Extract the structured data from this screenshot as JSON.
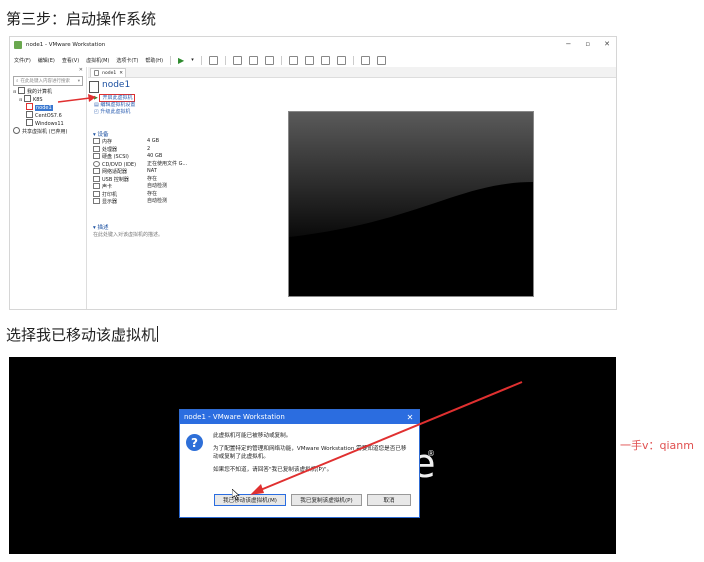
{
  "step3_title": "第三步：启动操作系统",
  "step2_title": "选择我已移动该虚拟机",
  "vmware": {
    "window_title": "node1 - VMware Workstation",
    "menus": [
      "文件(F)",
      "编辑(E)",
      "查看(V)",
      "虚拟机(M)",
      "选项卡(T)",
      "帮助(H)"
    ],
    "library": {
      "search_placeholder": "在此处键入内容进行搜索",
      "tree": [
        {
          "label": "我的计算机",
          "indent": 0
        },
        {
          "label": "K8S",
          "indent": 1
        },
        {
          "label": "node1",
          "indent": 2,
          "selected": true
        },
        {
          "label": "CentOS7.6",
          "indent": 2
        },
        {
          "label": "Windows11",
          "indent": 2
        },
        {
          "label": "共享虚拟机 (已弃用)",
          "indent": 0
        }
      ]
    },
    "tab_label": "node1",
    "vm_name": "node1",
    "actions": {
      "start": "开启此虚拟机",
      "edit": "编辑虚拟机设置",
      "upgrade": "升级此虚拟机"
    },
    "devices_heading": "设备",
    "devices": [
      {
        "name": "内存",
        "value": "4 GB"
      },
      {
        "name": "处理器",
        "value": "2"
      },
      {
        "name": "硬盘 (SCSI)",
        "value": "40 GB"
      },
      {
        "name": "CD/DVD (IDE)",
        "value": "正在使用文件 G..."
      },
      {
        "name": "网络适配器",
        "value": "NAT"
      },
      {
        "name": "USB 控制器",
        "value": "存在"
      },
      {
        "name": "声卡",
        "value": "自动检测"
      },
      {
        "name": "打印机",
        "value": "存在"
      },
      {
        "name": "显示器",
        "value": "自动检测"
      }
    ],
    "description_heading": "描述",
    "description_text": "在此处键入对该虚拟机的描述。"
  },
  "dialog": {
    "title": "node1 - VMware Workstation",
    "close_glyph": "✕",
    "line1": "此虚拟机可能已被移动或复制。",
    "line2": "为了配置特定的管理和网络功能，VMware Workstation 需要知道您是否已移动或复制了此虚拟机。",
    "line3": "如果您不知道，请回答\"我已复制该虚拟机(P)\"。",
    "btn_moved": "我已移动该虚拟机(M)",
    "btn_copied": "我已复制该虚拟机(P)",
    "btn_cancel": "取消"
  },
  "background_logo_fragment": "e",
  "background_logo_mark": "®",
  "side_note": "一手v：qianm",
  "colors": {
    "annotation_red": "#e03030",
    "dialog_title_blue": "#2b6de0",
    "link_blue": "#2a5db0"
  }
}
